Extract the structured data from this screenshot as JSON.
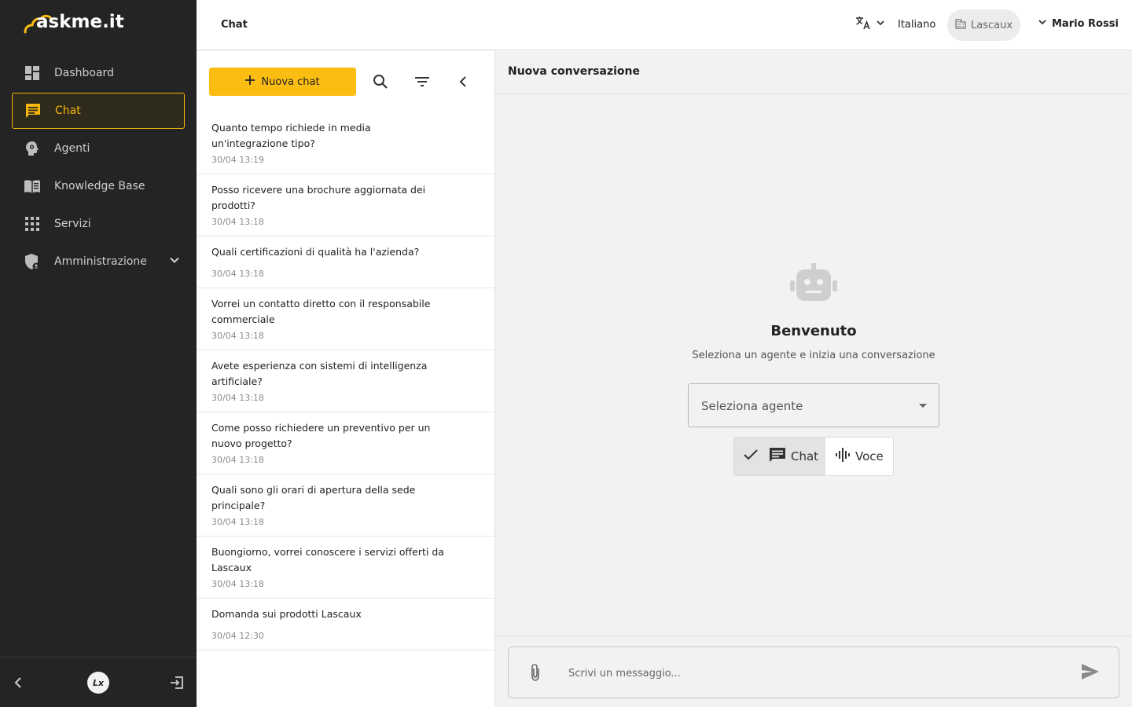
{
  "app": {
    "logo_text": "askme.it"
  },
  "sidebar": {
    "items": [
      {
        "label": "Dashboard",
        "icon": "dashboard-icon",
        "active": false
      },
      {
        "label": "Chat",
        "icon": "chat-icon",
        "active": true
      },
      {
        "label": "Agenti",
        "icon": "agent-icon",
        "active": false
      },
      {
        "label": "Knowledge Base",
        "icon": "book-icon",
        "active": false
      },
      {
        "label": "Servizi",
        "icon": "apps-grid-icon",
        "active": false
      },
      {
        "label": "Amministrazione",
        "icon": "admin-shield-icon",
        "active": false,
        "expandable": true
      }
    ],
    "footer_badge": "Lx"
  },
  "topbar": {
    "title": "Chat",
    "language": "Italiano",
    "organization": "Lascaux",
    "user": "Mario Rossi"
  },
  "chat_panel": {
    "new_chat_label": "Nuova chat",
    "chats": [
      {
        "title": "Quanto tempo richiede in media un'integrazione tipo?",
        "time": "30/04 13:19"
      },
      {
        "title": "Posso ricevere una brochure aggiornata dei prodotti?",
        "time": "30/04 13:18"
      },
      {
        "title": "Quali certificazioni di qualità ha l'azienda?",
        "time": "30/04 13:18"
      },
      {
        "title": "Vorrei un contatto diretto con il responsabile commerciale",
        "time": "30/04 13:18"
      },
      {
        "title": "Avete esperienza con sistemi di intelligenza artificiale?",
        "time": "30/04 13:18"
      },
      {
        "title": "Come posso richiedere un preventivo per un nuovo progetto?",
        "time": "30/04 13:18"
      },
      {
        "title": "Quali sono gli orari di apertura della sede principale?",
        "time": "30/04 13:18"
      },
      {
        "title": "Buongiorno, vorrei conoscere i servizi offerti da Lascaux",
        "time": "30/04 13:18"
      },
      {
        "title": "Domanda sui prodotti Lascaux",
        "time": "30/04 12:30"
      }
    ]
  },
  "main": {
    "title": "Nuova conversazione",
    "welcome_title": "Benvenuto",
    "welcome_subtitle": "Seleziona un agente e inizia una conversazione",
    "agent_select_placeholder": "Seleziona agente",
    "modes": [
      {
        "label": "Chat",
        "selected": true
      },
      {
        "label": "Voce",
        "selected": false
      }
    ],
    "message_placeholder": "Scrivi un messaggio..."
  },
  "colors": {
    "accent": "#fbbd12",
    "sidebar_bg": "#242424",
    "active_text": "#f5b50a"
  }
}
